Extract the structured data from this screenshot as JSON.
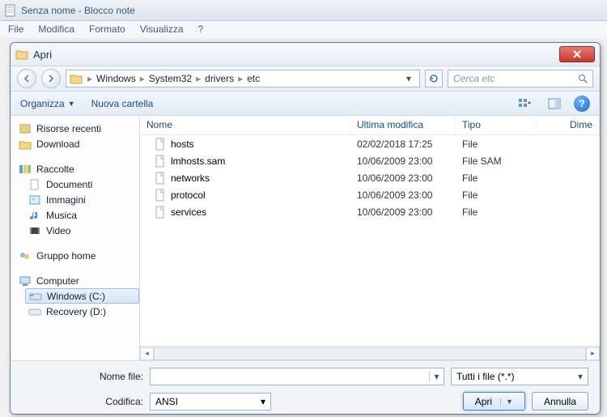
{
  "notepad": {
    "title": "Senza nome - Blocco note",
    "menu": [
      "File",
      "Modifica",
      "Formato",
      "Visualizza",
      "?"
    ]
  },
  "dialog": {
    "title": "Apri",
    "breadcrumb": [
      "Windows",
      "System32",
      "drivers",
      "etc"
    ],
    "search_placeholder": "Cerca etc",
    "organize_label": "Organizza",
    "newfolder_label": "Nuova cartella",
    "columns": {
      "name": "Nome",
      "modified": "Ultima modifica",
      "type": "Tipo",
      "dim": "Dime"
    },
    "files": [
      {
        "name": "hosts",
        "mod": "02/02/2018 17:25",
        "type": "File"
      },
      {
        "name": "lmhosts.sam",
        "mod": "10/06/2009 23:00",
        "type": "File SAM"
      },
      {
        "name": "networks",
        "mod": "10/06/2009 23:00",
        "type": "File"
      },
      {
        "name": "protocol",
        "mod": "10/06/2009 23:00",
        "type": "File"
      },
      {
        "name": "services",
        "mod": "10/06/2009 23:00",
        "type": "File"
      }
    ],
    "sidebar": {
      "recent": "Risorse recenti",
      "download": "Download",
      "libraries_head": "Raccolte",
      "documents": "Documenti",
      "images": "Immagini",
      "music": "Musica",
      "video": "Video",
      "homegroup": "Gruppo home",
      "computer_head": "Computer",
      "drive_c": "Windows (C:)",
      "drive_d": "Recovery (D:)"
    },
    "filename_label": "Nome file:",
    "filter_label": "Tutti i file  (*.*)",
    "encoding_label": "Codifica:",
    "encoding_value": "ANSI",
    "open_button": "Apri",
    "cancel_button": "Annulla"
  }
}
